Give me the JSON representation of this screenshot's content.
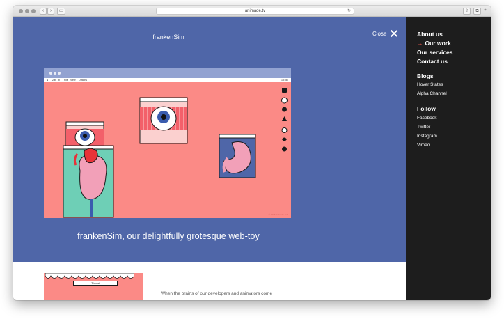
{
  "browser": {
    "url": "animade.tv"
  },
  "hero": {
    "title": "frankenSim",
    "close_label": "Close",
    "tagline": "frankenSim, our delightfully grotesque web-toy"
  },
  "illustration": {
    "menubar": [
      "Zan_fb",
      "File",
      "View",
      "Options"
    ],
    "menubar_time": "18:08",
    "window_labels": [
      "Brain",
      "Stomach"
    ],
    "footer": "© 2016 Animade Ltd"
  },
  "lower": {
    "window_label": "Throat",
    "intro_text": "When the brains of our developers and animators come"
  },
  "sidebar": {
    "nav": [
      {
        "label": "About us"
      },
      {
        "label": "Our work",
        "active": true,
        "marker": "→"
      },
      {
        "label": "Our services"
      },
      {
        "label": "Contact us"
      }
    ],
    "blogs_heading": "Blogs",
    "blogs": [
      "Hover States",
      "Alpha Channel"
    ],
    "follow_heading": "Follow",
    "follow": [
      "Facebook",
      "Twitter",
      "Instagram",
      "Vimeo"
    ]
  },
  "colors": {
    "hero_bg": "#4f66a8",
    "sidebar_bg": "#1d1d1d",
    "illustration_bg": "#fb8a86",
    "accent_arrow": "#f25a4e"
  }
}
